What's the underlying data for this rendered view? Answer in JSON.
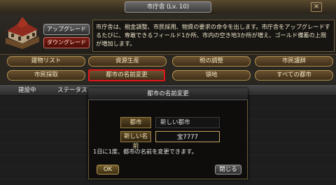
{
  "window": {
    "title": "市庁舎 (Lv. 10)",
    "close_glyph": "×"
  },
  "info": {
    "upgrade_label": "アップグレード",
    "downgrade_label": "ダウングレード",
    "description": "市庁舎は、税金調整、市民採用、物資の要求の命令を出します。市庁舎をアップグレードするたびに、専敢できるフィールド1か所、市内の空き地3か所が増え、ゴールド備蓄の上限が増加します。"
  },
  "nav": {
    "building_list": "建物リスト",
    "resource_production": "資源生産",
    "tax_adjust": "税の調整",
    "citizen_council": "市民議辞",
    "citizen_recruit": "市民採取",
    "rename_city": "都市の名前変更",
    "territory": "領地",
    "all_cities": "すべての都市"
  },
  "table": {
    "columns": [
      "建設中",
      "ステータス"
    ]
  },
  "dialog": {
    "title": "都市の名前変更",
    "city_label": "都市",
    "current_city_name": "新しい都市",
    "new_name_label": "新しい名前",
    "new_name_value": "宝7777",
    "note": "1日に1度、都市の名前を変更できます。",
    "ok_label": "OK",
    "close_label": "閉じる"
  },
  "colors": {
    "highlight_border": "#e0141a",
    "accent_gold": "#b08f55"
  }
}
